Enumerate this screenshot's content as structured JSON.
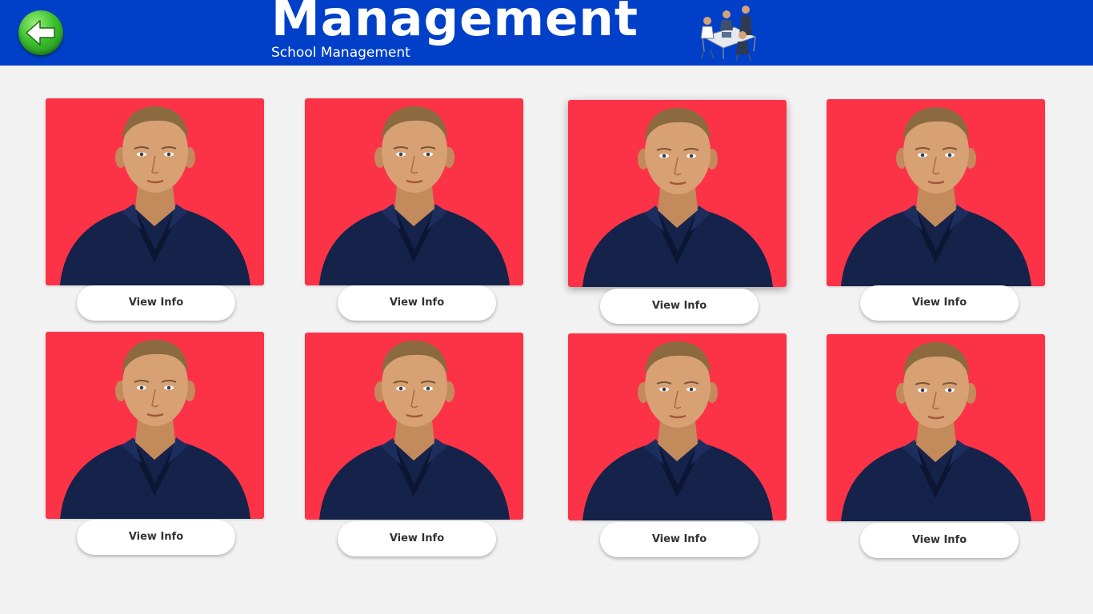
{
  "header": {
    "title": "Management",
    "subtitle": "School Management",
    "back_icon": "arrow-left-icon",
    "illustration_icon": "meeting-illustration",
    "background_color": "#0040c8"
  },
  "grid": {
    "photo_background_color": "#fc3347",
    "items": [
      {
        "button_label": "View Info"
      },
      {
        "button_label": "View Info"
      },
      {
        "button_label": "View Info"
      },
      {
        "button_label": "View Info"
      },
      {
        "button_label": "View Info"
      },
      {
        "button_label": "View Info"
      },
      {
        "button_label": "View Info"
      },
      {
        "button_label": "View Info"
      }
    ]
  }
}
